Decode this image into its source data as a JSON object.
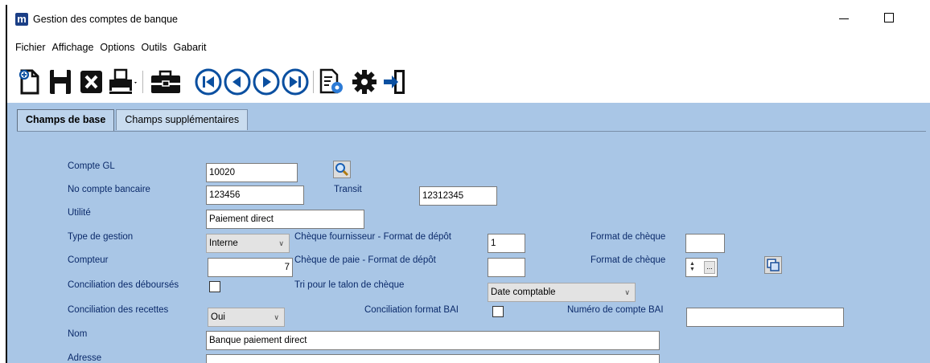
{
  "window": {
    "title": "Gestion des comptes de banque",
    "app_icon": "m"
  },
  "menu": [
    "Fichier",
    "Affichage",
    "Options",
    "Outils",
    "Gabarit"
  ],
  "toolbar": {
    "icons": [
      "new-icon",
      "save-icon",
      "delete-icon",
      "print-icon",
      "briefcase-icon",
      "first-record-icon",
      "previous-record-icon",
      "next-record-icon",
      "last-record-icon",
      "report-settings-icon",
      "settings-icon",
      "exit-icon"
    ]
  },
  "tabs": [
    "Champs de base",
    "Champs supplémentaires"
  ],
  "form": {
    "compte_gl": {
      "label": "Compte GL",
      "value": "10020"
    },
    "no_compte": {
      "label": "No compte bancaire",
      "value": "123456"
    },
    "transit": {
      "label": "Transit",
      "value": "12312345"
    },
    "utilite": {
      "label": "Utilité",
      "value": "Paiement direct"
    },
    "type_gestion": {
      "label": "Type de gestion",
      "value": "Interne"
    },
    "cheque_fournisseur": {
      "label": "Chèque fournisseur - Format de dépôt",
      "value": "1"
    },
    "format_cheque_1": {
      "label": "Format de chèque",
      "value": ""
    },
    "compteur": {
      "label": "Compteur",
      "value": "7"
    },
    "cheque_paie": {
      "label": "Chèque de paie - Format de dépôt",
      "value": ""
    },
    "format_cheque_2": {
      "label": "Format de chèque",
      "value": ""
    },
    "conciliation_debourses": {
      "label": "Conciliation des déboursés",
      "checked": false
    },
    "tri_talon": {
      "label": "Tri pour le talon de chèque",
      "value": "Date comptable"
    },
    "conciliation_recettes": {
      "label": "Conciliation des recettes",
      "value": "Oui"
    },
    "conciliation_bai": {
      "label": "Conciliation format BAI",
      "checked": false
    },
    "numero_bai": {
      "label": "Numéro de compte BAI",
      "value": ""
    },
    "nom": {
      "label": "Nom",
      "value": "Banque paiement direct"
    },
    "adresse": {
      "label": "Adresse",
      "value": ""
    }
  },
  "colors": {
    "panel": "#a9c6e6",
    "label_text": "#0b2a6a",
    "icon_blue": "#0a4fa0"
  }
}
